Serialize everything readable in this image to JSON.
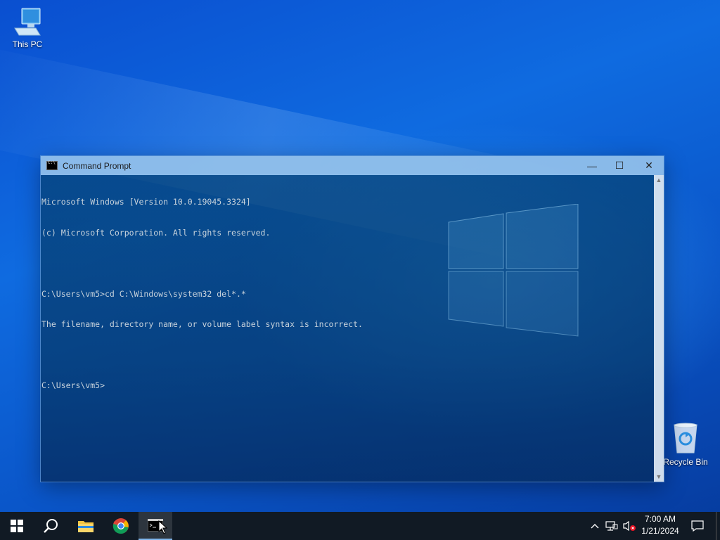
{
  "desktop": {
    "icons": [
      {
        "label": "This PC"
      },
      {
        "label": "Recycle Bin"
      }
    ]
  },
  "window": {
    "title": "Command Prompt",
    "controls": {
      "minimize": "—",
      "maximize": "☐",
      "close": "✕"
    },
    "console_lines": [
      "Microsoft Windows [Version 10.0.19045.3324]",
      "(c) Microsoft Corporation. All rights reserved.",
      "",
      "C:\\Users\\vm5>cd C:\\Windows\\system32 del*.*",
      "The filename, directory name, or volume label syntax is incorrect.",
      "",
      "C:\\Users\\vm5>"
    ]
  },
  "taskbar": {
    "buttons": [
      "start-icon",
      "search-icon",
      "file-explorer-icon",
      "chrome-icon",
      "command-prompt-icon"
    ],
    "tray": {
      "time": "7:00 AM",
      "date": "1/21/2024"
    }
  },
  "colors": {
    "taskbar_bg": "#111a24",
    "desktop_accent": "#0f6be0",
    "console_text": "#c8d3dc"
  }
}
